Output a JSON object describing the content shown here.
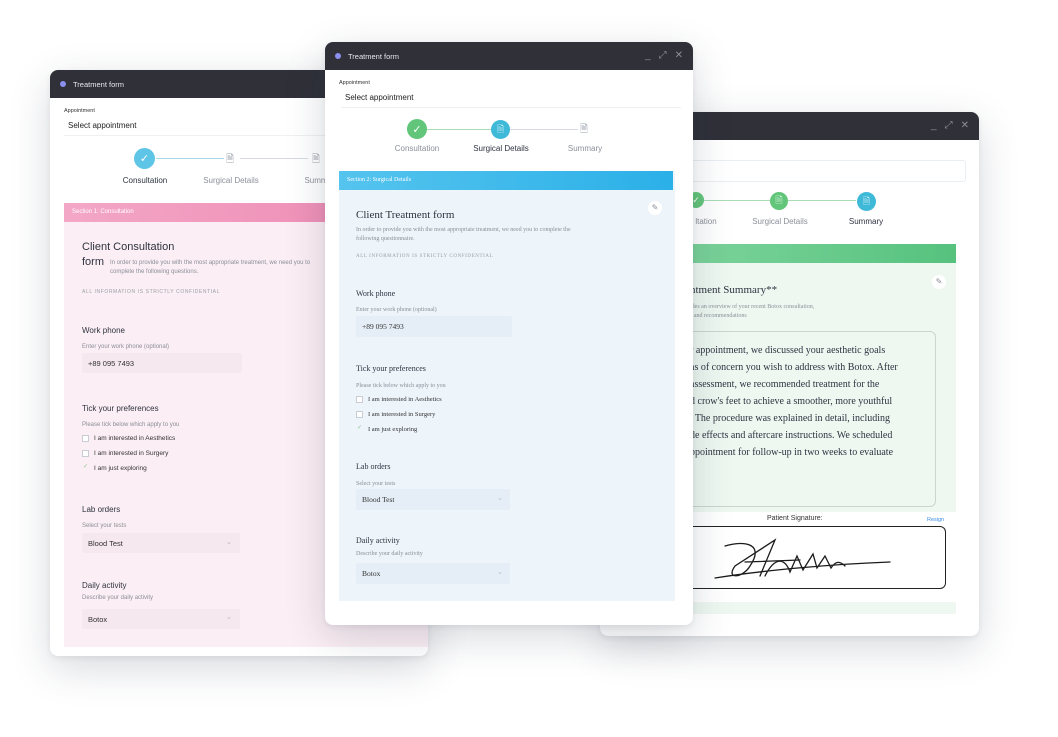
{
  "colors": {
    "pink_band": "#f29abd",
    "blue_band": "#39b8ea",
    "green_band": "#67c98a",
    "step_done": "#5ec5e6",
    "step_green": "#62c67a"
  },
  "left": {
    "title": "Treatment form",
    "appointment_label": "Appointment",
    "appointment_value": "Select appointment",
    "steps": [
      "Consultation",
      "Surgical Details",
      "Summ"
    ],
    "section": "Section 1: Consultation",
    "form_title_1": "Client Consultation",
    "form_title_2": "form",
    "intro": "In order to provide you with the most appropriate treatment, we need you to complete the following questions.",
    "confidential": "ALL INFORMATION IS STRICTLY CONFIDENTIAL",
    "work_phone_label": "Work phone",
    "work_phone_hint": "Enter your work phone (optional)",
    "work_phone_value": "+89 095 7493",
    "prefs_label": "Tick your preferences",
    "prefs_hint": "Please tick below which apply to you",
    "prefs": [
      "I am interested in Aesthetics",
      "I am interested in Surgery",
      "I am just exploring"
    ],
    "lab_label": "Lab orders",
    "lab_hint": "Select your tests",
    "lab_value": "Blood Test",
    "daily_label": "Daily activity",
    "daily_hint": "Describe your daily activity",
    "daily_value": "Botox"
  },
  "center": {
    "title": "Treatment form",
    "appointment_label": "Appointment",
    "appointment_value": "Select appointment",
    "steps": [
      "Consultation",
      "Surgical Details",
      "Summary"
    ],
    "section": "Section 2: Surgical Details",
    "form_title": "Client Treatment form",
    "intro": "In order to provide you with the most appropriate treatment, we need you to complete the following questionnaire.",
    "confidential": "ALL INFORMATION IS STRICTLY CONFIDENTIAL",
    "work_phone_label": "Work phone",
    "work_phone_hint": "Enter your work phone (optional)",
    "work_phone_value": "+89 095 7493",
    "prefs_label": "Tick your preferences",
    "prefs_hint": "Please tick below which apply to you",
    "prefs": [
      "I am interested in Aesthetics",
      "I am interested in Surgery",
      "I am just exploring"
    ],
    "lab_label": "Lab orders",
    "lab_hint": "Select your tests",
    "lab_value": "Blood Test",
    "daily_label": "Daily activity",
    "daily_hint": "Describe your daily activity",
    "daily_value": "Botox"
  },
  "right": {
    "steps": [
      "ltation",
      "Surgical Details",
      "Summary"
    ],
    "summary_title": "ntment Summary**",
    "summary_sub_1": "ides an overview of your recent Botox consultation,",
    "summary_sub_2": "s and recommendations",
    "summary_lines": [
      "r appointment, we discussed your aesthetic goals",
      "as of concern you wish to address with Botox. After",
      "assessment, we recommended treatment for the",
      "d crow's feet to achieve a smoother, more youthful",
      ". The procedure was explained in detail, including",
      "de effects and aftercare instructions. We scheduled",
      "ppointment for follow-up in two weeks to evaluate"
    ],
    "signature_label": "Patient Signature:",
    "resign_label": "Resign"
  }
}
